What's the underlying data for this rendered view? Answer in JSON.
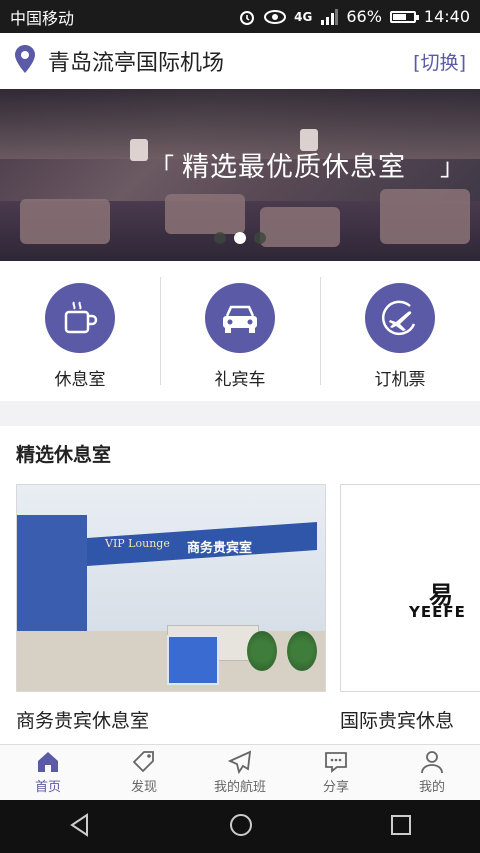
{
  "status_bar": {
    "carrier": "中国移动",
    "network_label": "4G",
    "battery_percent": "66%",
    "battery_level": 0.66,
    "time": "14:40"
  },
  "location": {
    "name": "青岛流亭国际机场",
    "switch_label": "[切换]"
  },
  "banner": {
    "caption": "精选最优质休息室",
    "bracket_open": "「",
    "bracket_close": "」",
    "page_count": 3,
    "active_page": 2
  },
  "services": [
    {
      "label": "休息室",
      "icon": "coffee-cup-icon"
    },
    {
      "label": "礼宾车",
      "icon": "car-icon"
    },
    {
      "label": "订机票",
      "icon": "airplane-ticket-icon"
    }
  ],
  "featured": {
    "title": "精选休息室",
    "cards": [
      {
        "title": "商务贵宾休息室",
        "sign_cn": "商务贵宾室",
        "sign_en": "VIP Lounge"
      },
      {
        "title": "国际贵宾休息",
        "brand_mark": "易",
        "brand_text": "YEEFE"
      }
    ]
  },
  "tabs": [
    {
      "label": "首页",
      "icon": "home-icon",
      "active": true
    },
    {
      "label": "发现",
      "icon": "tag-icon",
      "active": false
    },
    {
      "label": "我的航班",
      "icon": "paper-plane-icon",
      "active": false
    },
    {
      "label": "分享",
      "icon": "share-chat-icon",
      "active": false
    },
    {
      "label": "我的",
      "icon": "person-icon",
      "active": false
    }
  ],
  "colors": {
    "accent": "#5b5aa6",
    "status_bar": "#1b1b1b",
    "nav_bar": "#111111"
  }
}
